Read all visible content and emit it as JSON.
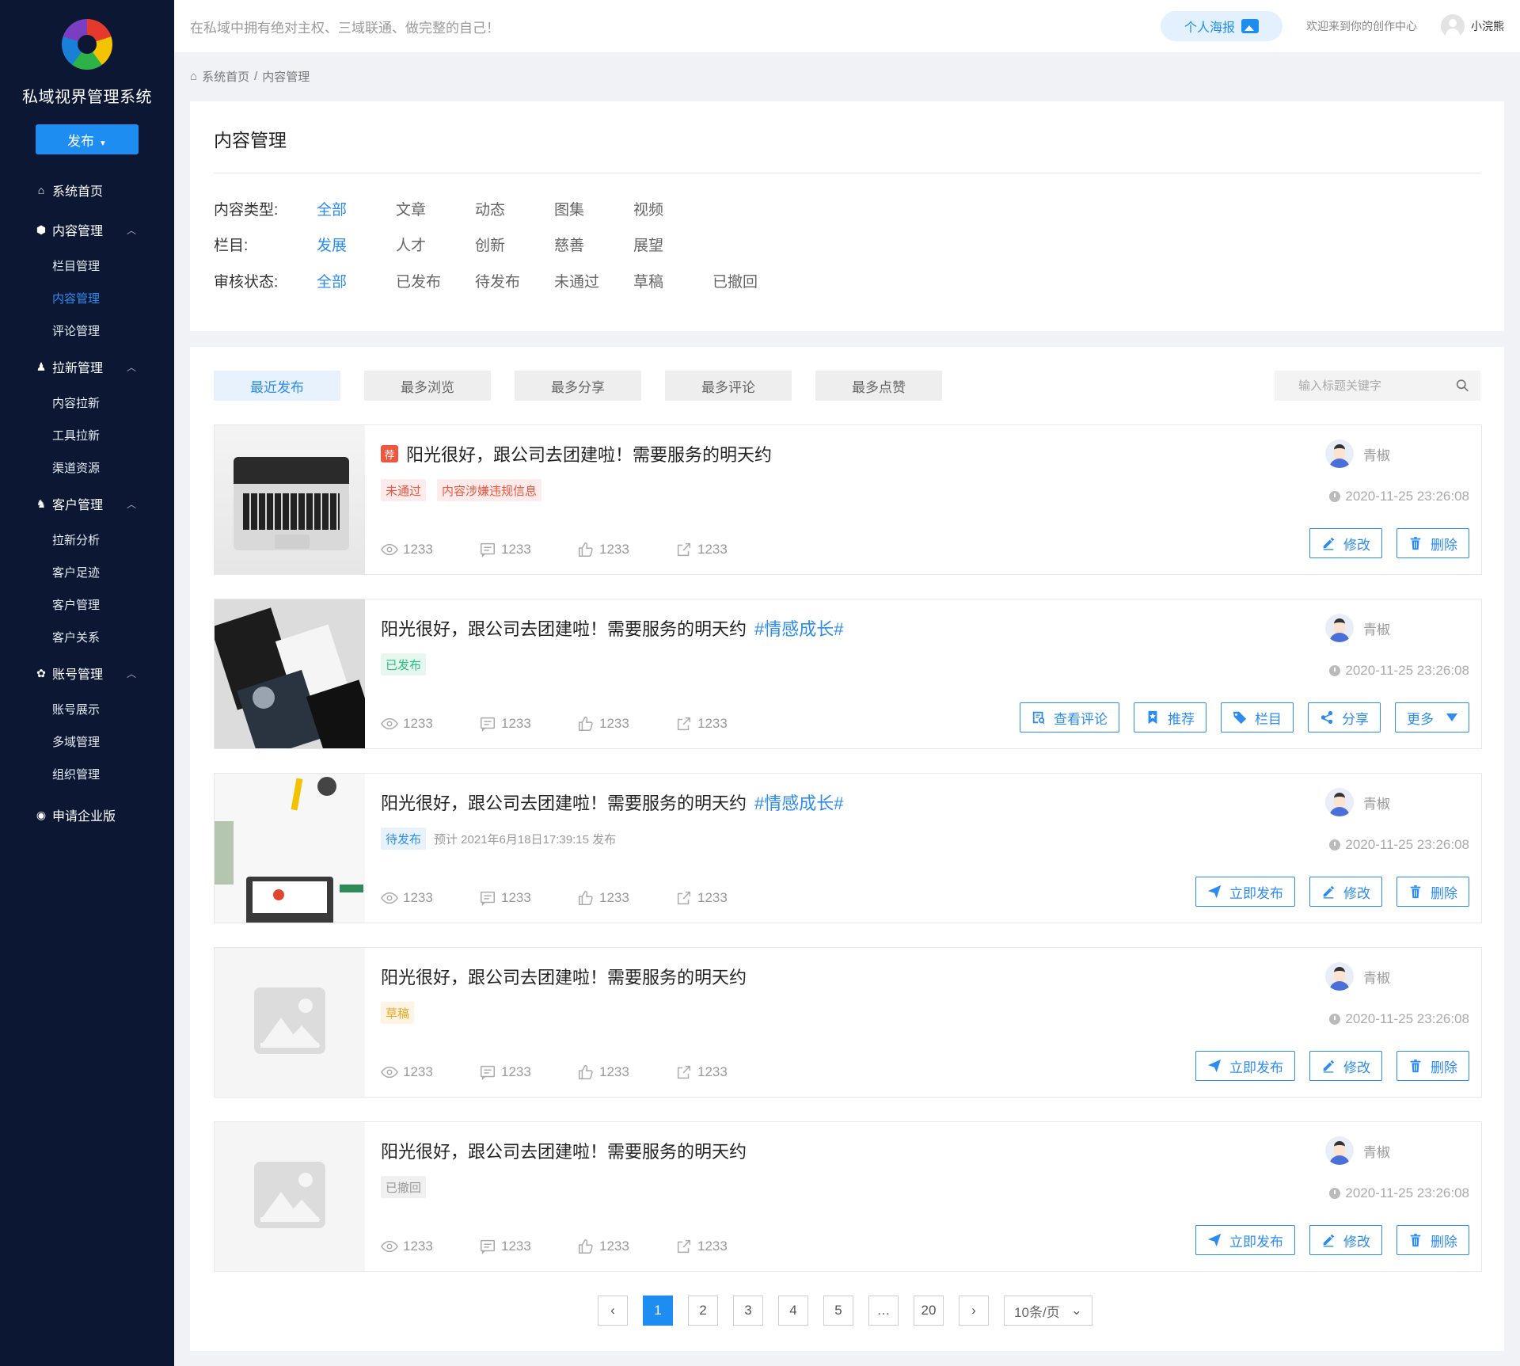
{
  "sidebar": {
    "brand": "私域视界管理系统",
    "publish": "发布",
    "nav": [
      {
        "label": "系统首页",
        "icon": "home-icon"
      },
      {
        "label": "内容管理",
        "icon": "cube-icon",
        "children": [
          "栏目管理",
          "内容管理",
          "评论管理"
        ],
        "active_child": "内容管理"
      },
      {
        "label": "拉新管理",
        "icon": "user-icon",
        "children": [
          "内容拉新",
          "工具拉新",
          "渠道资源"
        ]
      },
      {
        "label": "客户管理",
        "icon": "users-icon",
        "children": [
          "拉新分析",
          "客户足迹",
          "客户管理",
          "客户关系"
        ]
      },
      {
        "label": "账号管理",
        "icon": "gear-icon",
        "children": [
          "账号展示",
          "多域管理",
          "组织管理"
        ]
      },
      {
        "label": "申请企业版",
        "icon": "enterprise-icon"
      }
    ]
  },
  "topbar": {
    "slogan": "在私域中拥有绝对主权、三域联通、做完整的自己！",
    "poster": "个人海报",
    "welcome": "欢迎来到你的创作中心",
    "username": "小浣熊"
  },
  "breadcrumb": {
    "home": "系统首页",
    "sep": "/",
    "current": "内容管理"
  },
  "filter": {
    "title": "内容管理",
    "rows": [
      {
        "label": "内容类型:",
        "options": [
          "全部",
          "文章",
          "动态",
          "图集",
          "视频"
        ],
        "active": 0
      },
      {
        "label": "栏目:",
        "options": [
          "发展",
          "人才",
          "创新",
          "慈善",
          "展望"
        ],
        "active": 0
      },
      {
        "label": "审核状态:",
        "options": [
          "全部",
          "已发布",
          "待发布",
          "未通过",
          "草稿",
          "已撤回"
        ],
        "active": 0
      }
    ]
  },
  "sort_tabs": [
    "最近发布",
    "最多浏览",
    "最多分享",
    "最多评论",
    "最多点赞"
  ],
  "search": {
    "placeholder": "输入标题关键字"
  },
  "items": [
    {
      "title": "阳光很好，跟公司去团建啦！需要服务的明天约",
      "recommend": "荐",
      "hashtag": "",
      "tags": [
        {
          "text": "未通过",
          "color": "red"
        },
        {
          "text": "内容涉嫌违规信息",
          "color": "red"
        }
      ],
      "schedule": "",
      "stats": {
        "views": "1233",
        "comments": "1233",
        "likes": "1233",
        "shares": "1233"
      },
      "author": "青椒",
      "time": "2020-11-25 23:26:08",
      "actions": [
        "修改",
        "删除"
      ],
      "thumb": "laptop"
    },
    {
      "title": "阳光很好，跟公司去团建啦！需要服务的明天约",
      "recommend": "",
      "hashtag": "#情感成长#",
      "tags": [
        {
          "text": "已发布",
          "color": "green"
        }
      ],
      "schedule": "",
      "stats": {
        "views": "1233",
        "comments": "1233",
        "likes": "1233",
        "shares": "1233"
      },
      "author": "青椒",
      "time": "2020-11-25 23:26:08",
      "actions": [
        "查看评论",
        "推荐",
        "栏目",
        "分享",
        "更多"
      ],
      "thumb": "cards"
    },
    {
      "title": "阳光很好，跟公司去团建啦！需要服务的明天约",
      "recommend": "",
      "hashtag": "#情感成长#",
      "tags": [
        {
          "text": "待发布",
          "color": "blue"
        }
      ],
      "schedule": "预计 2021年6月18日17:39:15 发布",
      "stats": {
        "views": "1233",
        "comments": "1233",
        "likes": "1233",
        "shares": "1233"
      },
      "author": "青椒",
      "time": "2020-11-25 23:26:08",
      "actions": [
        "立即发布",
        "修改",
        "删除"
      ],
      "thumb": "desk"
    },
    {
      "title": "阳光很好，跟公司去团建啦！需要服务的明天约",
      "recommend": "",
      "hashtag": "",
      "tags": [
        {
          "text": "草稿",
          "color": "orange"
        }
      ],
      "schedule": "",
      "stats": {
        "views": "1233",
        "comments": "1233",
        "likes": "1233",
        "shares": "1233"
      },
      "author": "青椒",
      "time": "2020-11-25 23:26:08",
      "actions": [
        "立即发布",
        "修改",
        "删除"
      ],
      "thumb": "placeholder"
    },
    {
      "title": "阳光很好，跟公司去团建啦！需要服务的明天约",
      "recommend": "",
      "hashtag": "",
      "tags": [
        {
          "text": "已撤回",
          "color": "gray"
        }
      ],
      "schedule": "",
      "stats": {
        "views": "1233",
        "comments": "1233",
        "likes": "1233",
        "shares": "1233"
      },
      "author": "青椒",
      "time": "2020-11-25 23:26:08",
      "actions": [
        "立即发布",
        "修改",
        "删除"
      ],
      "thumb": "placeholder"
    }
  ],
  "pagination": {
    "pages": [
      "1",
      "2",
      "3",
      "4",
      "5",
      "…",
      "20"
    ],
    "current": "1",
    "page_size": "10条/页"
  },
  "colors": {
    "sidebar": "#0b1733",
    "accent": "#1e8df2",
    "link": "#2d8cf0"
  }
}
